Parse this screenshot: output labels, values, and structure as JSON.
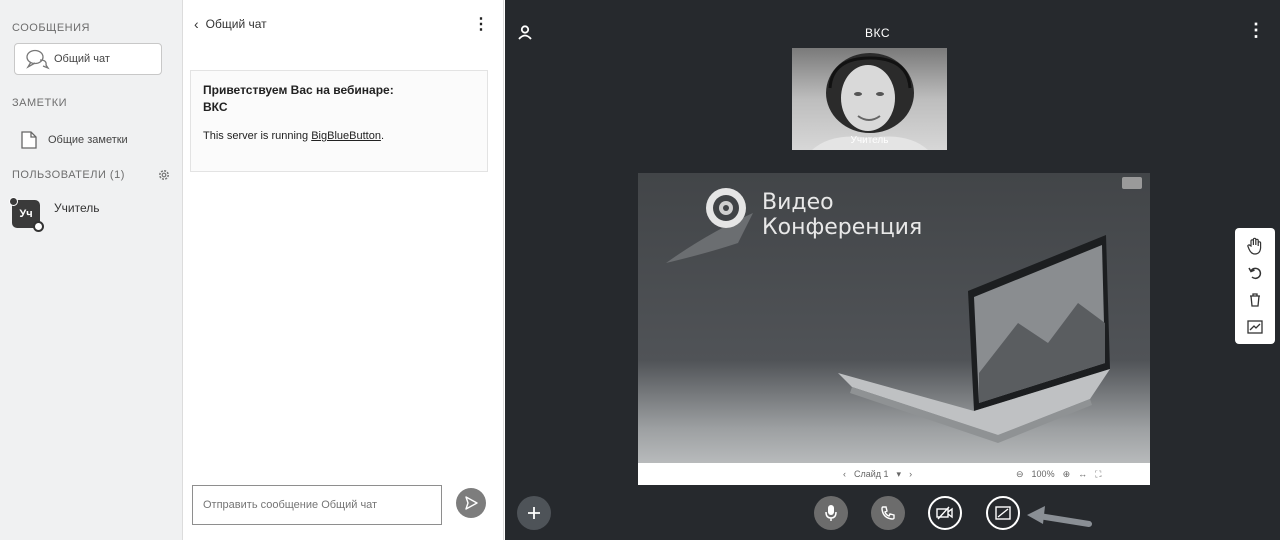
{
  "sidebar": {
    "messages_title": "СООБЩЕНИЯ",
    "chat_item_label": "Общий чат",
    "notes_title": "ЗАМЕТКИ",
    "notes_item_label": "Общие заметки",
    "users_title": "ПОЛЬЗОВАТЕЛИ (1)",
    "users": [
      {
        "initials": "Уч",
        "name": "Учитель"
      }
    ]
  },
  "chat": {
    "back_label": "Общий чат",
    "welcome_line1": "Приветствуем Вас на вебинаре:",
    "welcome_line2": "ВКС",
    "server_text": "This server is running ",
    "server_link": "BigBlueButton",
    "server_suffix": ".",
    "input_placeholder": "Отправить сообщение Общий чат"
  },
  "main": {
    "meeting_title": "ВКС",
    "webcam_name": "Учитель",
    "slide": {
      "title_line1": "Видео",
      "title_line2": "Конференция",
      "slide_selector": "Слайд 1",
      "zoom_level": "100%"
    }
  },
  "colors": {
    "main_bg": "#26292d",
    "sidebar_bg": "#f0f1f2",
    "button_gray": "#6c6c6c"
  }
}
